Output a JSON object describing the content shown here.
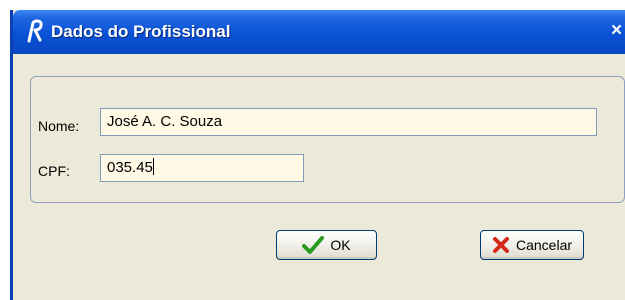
{
  "window": {
    "title": "Dados do Profissional",
    "close_glyph": "×",
    "app_icon": "r-logo-icon"
  },
  "form": {
    "nome_label": "Nome:",
    "nome_value": "José A. C. Souza",
    "cpf_label": "CPF:",
    "cpf_value": "035.45"
  },
  "buttons": {
    "ok_label": "OK",
    "ok_icon": "checkmark-icon",
    "cancel_label": "Cancelar",
    "cancel_icon": "x-mark-icon"
  },
  "colors": {
    "titlebar": "#0a52d6",
    "dialog_bg": "#ece9d8",
    "field_bg": "#fff9e6",
    "ok_check": "#2a9a1f",
    "cancel_x": "#d42a1a"
  }
}
